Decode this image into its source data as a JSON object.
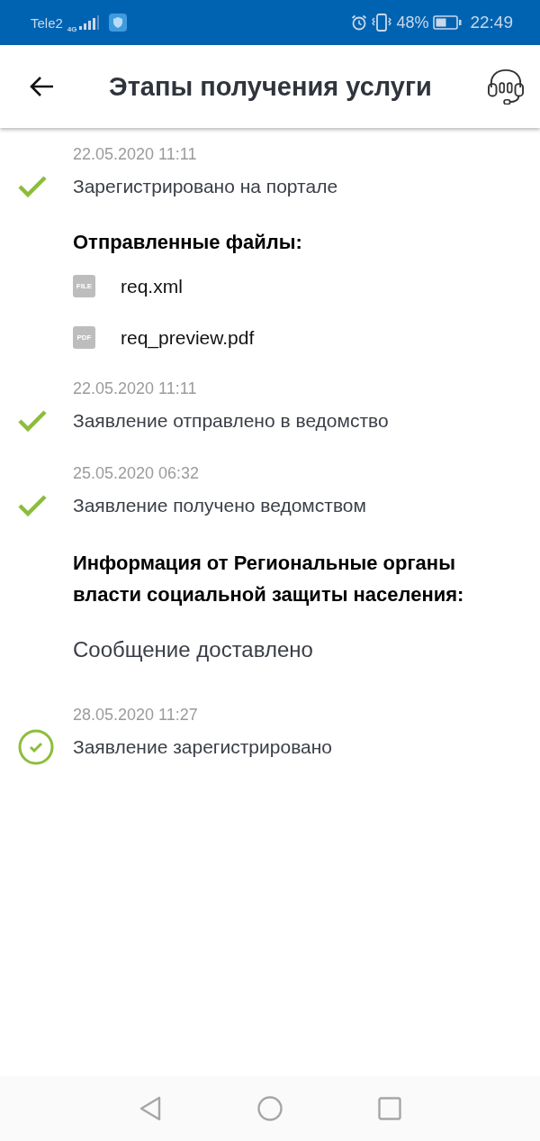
{
  "status_bar": {
    "carrier": "Tele2",
    "network": "4G",
    "battery_percent": "48%",
    "time": "22:49"
  },
  "header": {
    "title": "Этапы получения услуги"
  },
  "timeline": [
    {
      "kind": "step",
      "date": "22.05.2020 11:11",
      "text": "Зарегистрировано на портале",
      "current": false
    },
    {
      "kind": "files",
      "heading": "Отправленные файлы:",
      "files": [
        {
          "type_label": "FILE",
          "name": "req.xml"
        },
        {
          "type_label": "PDF",
          "name": "req_preview.pdf"
        }
      ]
    },
    {
      "kind": "step",
      "date": "22.05.2020 11:11",
      "text": "Заявление отправлено в ведомство",
      "current": false
    },
    {
      "kind": "step",
      "date": "25.05.2020 06:32",
      "text": "Заявление получено ведомством",
      "current": false
    },
    {
      "kind": "info",
      "heading": "Информация от Региональные органы власти социальной защиты населения:",
      "text": "Сообщение доставлено"
    },
    {
      "kind": "step",
      "date": "28.05.2020 11:27",
      "text": "Заявление зарегистрировано",
      "current": true
    }
  ]
}
